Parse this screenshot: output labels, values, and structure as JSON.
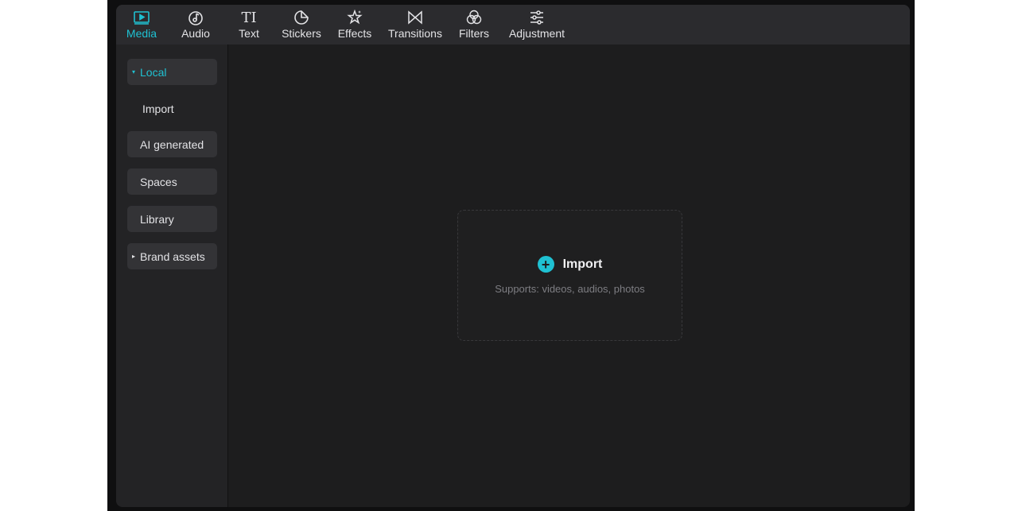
{
  "toolbar": {
    "tabs": [
      {
        "label": "Media",
        "icon": "media-play-icon",
        "active": true
      },
      {
        "label": "Audio",
        "icon": "audio-note-icon"
      },
      {
        "label": "Text",
        "icon": "text-ti-icon",
        "glyph": "TI"
      },
      {
        "label": "Stickers",
        "icon": "sticker-icon"
      },
      {
        "label": "Effects",
        "icon": "effects-star-icon"
      },
      {
        "label": "Transitions",
        "icon": "transitions-bowtie-icon"
      },
      {
        "label": "Filters",
        "icon": "filters-circles-icon"
      },
      {
        "label": "Adjustment",
        "icon": "adjustment-sliders-icon"
      }
    ]
  },
  "sidebar": {
    "items": [
      {
        "label": "Local",
        "caret": "▾",
        "active": true
      },
      {
        "label": "Import"
      },
      {
        "label": "AI generated"
      },
      {
        "label": "Spaces"
      },
      {
        "label": "Library"
      },
      {
        "label": "Brand assets",
        "caret": "▸"
      }
    ]
  },
  "main": {
    "import_label": "Import",
    "plus_glyph": "+",
    "supports_text": "Supports: videos, audios, photos"
  },
  "colors": {
    "accent": "#1fc1d2",
    "panel_bg": "#1d1d1e",
    "toolbar_bg": "#2b2b2e",
    "sidebar_bg": "#232325"
  }
}
